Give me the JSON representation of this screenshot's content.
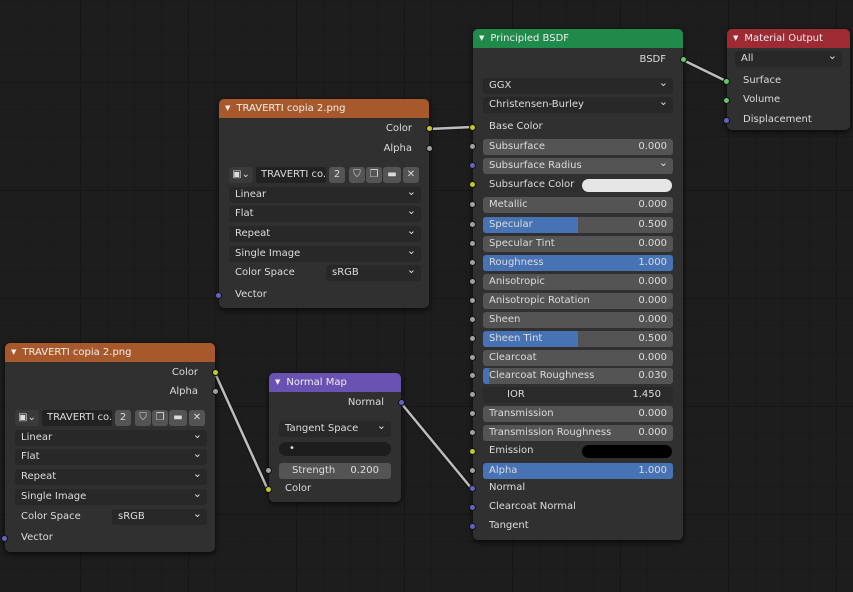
{
  "image_node_1": {
    "title": "TRAVERTI copia 2.png",
    "out_color": "Color",
    "out_alpha": "Alpha",
    "image_name": "TRAVERTI co..",
    "users": "2",
    "interpolation": "Linear",
    "projection": "Flat",
    "extension": "Repeat",
    "source": "Single Image",
    "color_space_label": "Color Space",
    "color_space": "sRGB",
    "in_vector": "Vector"
  },
  "image_node_2": {
    "title": "TRAVERTI copia 2.png",
    "out_color": "Color",
    "out_alpha": "Alpha",
    "image_name": "TRAVERTI co..",
    "users": "2",
    "interpolation": "Linear",
    "projection": "Flat",
    "extension": "Repeat",
    "source": "Single Image",
    "color_space_label": "Color Space",
    "color_space": "sRGB",
    "in_vector": "Vector"
  },
  "normal_map": {
    "title": "Normal Map",
    "out_normal": "Normal",
    "space": "Tangent Space",
    "uv": "•",
    "strength_label": "Strength",
    "strength_value": "0.200",
    "in_color": "Color"
  },
  "bsdf": {
    "title": "Principled BSDF",
    "out_bsdf": "BSDF",
    "distribution": "GGX",
    "subsurface_method": "Christensen-Burley",
    "base_color": "Base Color",
    "subsurface_radius": "Subsurface Radius",
    "subsurface_color": "Subsurface Color",
    "emission": "Emission",
    "normal": "Normal",
    "clearcoat_normal": "Clearcoat Normal",
    "tangent": "Tangent",
    "fields": [
      {
        "label": "Subsurface",
        "value": "0.000",
        "fill": 0
      },
      {
        "label": "Metallic",
        "value": "0.000",
        "fill": 0
      },
      {
        "label": "Specular",
        "value": "0.500",
        "fill": 0.5
      },
      {
        "label": "Specular Tint",
        "value": "0.000",
        "fill": 0
      },
      {
        "label": "Roughness",
        "value": "1.000",
        "fill": 1
      },
      {
        "label": "Anisotropic",
        "value": "0.000",
        "fill": 0
      },
      {
        "label": "Anisotropic Rotation",
        "value": "0.000",
        "fill": 0
      },
      {
        "label": "Sheen",
        "value": "0.000",
        "fill": 0
      },
      {
        "label": "Sheen Tint",
        "value": "0.500",
        "fill": 0.5
      },
      {
        "label": "Clearcoat",
        "value": "0.000",
        "fill": 0
      },
      {
        "label": "Clearcoat Roughness",
        "value": "0.030",
        "fill": 0.03
      },
      {
        "label": "IOR",
        "value": "1.450",
        "fill": 0
      },
      {
        "label": "Transmission",
        "value": "0.000",
        "fill": 0
      },
      {
        "label": "Transmission Roughness",
        "value": "0.000",
        "fill": 0
      },
      {
        "label": "Alpha",
        "value": "1.000",
        "fill": 1
      }
    ],
    "colors": {
      "subsurface_color": "#e6e6e6",
      "emission": "#000000"
    }
  },
  "output": {
    "title": "Material Output",
    "target": "All",
    "surface": "Surface",
    "volume": "Volume",
    "displacement": "Displacement"
  },
  "colors": {
    "image_header": "#a8592b",
    "normal_header": "#6a52b2",
    "bsdf_header": "#1f8a4a",
    "output_header": "#9e2a33",
    "slider_fill": "#4772b3",
    "socket_color": "#c7c729",
    "socket_float": "#a1a1a1",
    "socket_vector": "#6363c7",
    "socket_shader": "#63c763"
  }
}
